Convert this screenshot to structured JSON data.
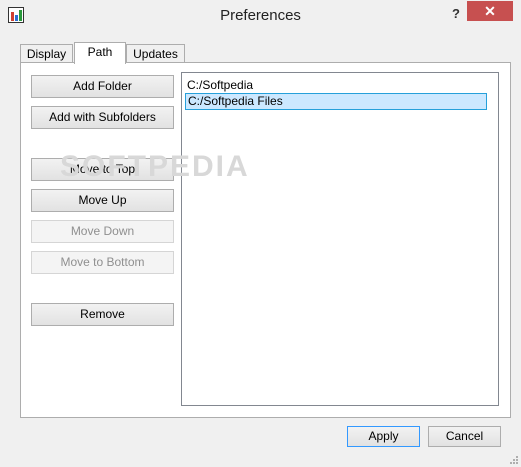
{
  "window": {
    "title": "Preferences",
    "help_glyph": "?",
    "close_glyph": "✕"
  },
  "tabs": [
    {
      "label": "Display"
    },
    {
      "label": "Path"
    },
    {
      "label": "Updates"
    }
  ],
  "buttons": {
    "add_folder": "Add Folder",
    "add_with_subfolders": "Add with Subfolders",
    "move_to_top": "Move to Top",
    "move_up": "Move Up",
    "move_down": "Move Down",
    "move_to_bottom": "Move to Bottom",
    "remove": "Remove"
  },
  "paths": [
    {
      "path": "C:/Softpedia",
      "selected": false
    },
    {
      "path": "C:/Softpedia Files",
      "selected": true
    }
  ],
  "watermark": "SOFTPEDIA",
  "footer": {
    "apply": "Apply",
    "cancel": "Cancel"
  }
}
